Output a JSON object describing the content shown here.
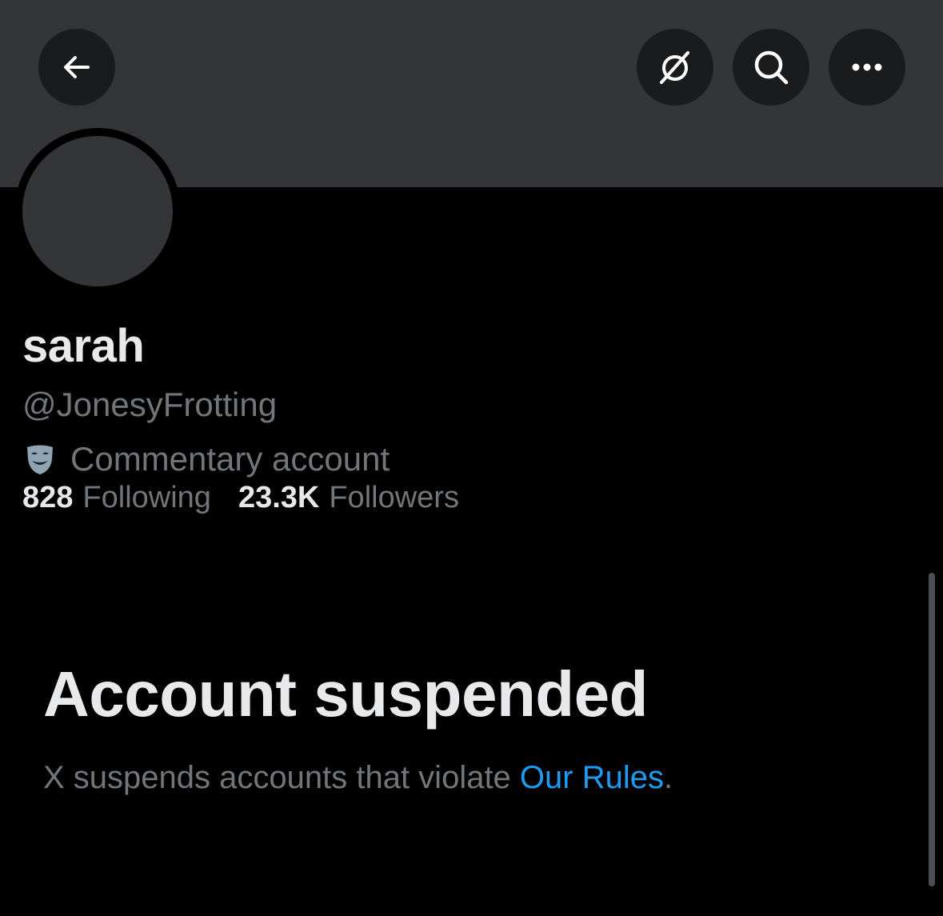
{
  "header": {
    "back_icon": "arrow-left-icon",
    "grok_icon": "grok-icon",
    "search_icon": "search-icon",
    "more_icon": "more-horizontal-icon"
  },
  "profile": {
    "display_name": "sarah",
    "handle": "@JonesyFrotting",
    "label_icon": "theater-mask-icon",
    "label_text": "Commentary account",
    "following_count": "828",
    "following_label": "Following",
    "followers_count": "23.3K",
    "followers_label": "Followers"
  },
  "suspension": {
    "title": "Account suspended",
    "message": "X suspends accounts that violate ",
    "link_text": "Our Rules",
    "period": "."
  },
  "colors": {
    "background": "#000000",
    "banner": "#333539",
    "primary_text": "#e7e9ea",
    "secondary_text": "#71767b",
    "link": "#1d9bf0"
  }
}
